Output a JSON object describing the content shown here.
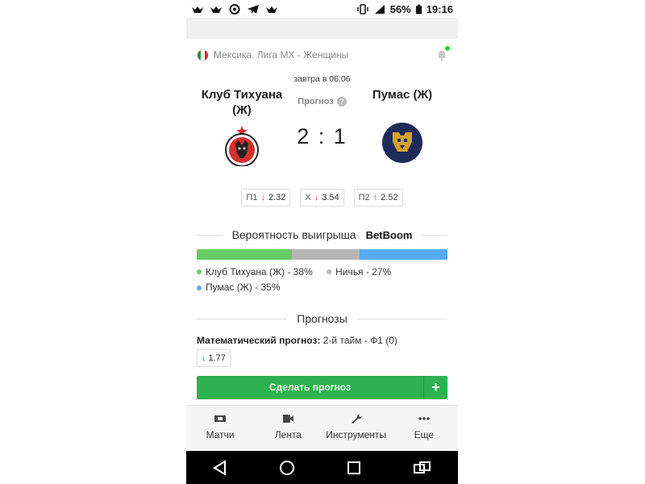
{
  "status_bar": {
    "battery": "56%",
    "time": "19:16"
  },
  "match": {
    "league": "Мексика. Лига MX - Женщины",
    "kickoff": "завтра в 06:06",
    "home": {
      "name": "Клуб Тихуана (Ж)"
    },
    "away": {
      "name": "Пумас (Ж)"
    },
    "forecast_label": "Прогноз",
    "score": "2 : 1"
  },
  "odds": [
    {
      "label": "П1",
      "value": "2.32",
      "trend": "down"
    },
    {
      "label": "Х",
      "value": "3.54",
      "trend": "down"
    },
    {
      "label": "П2",
      "value": "2.52",
      "trend": "up"
    }
  ],
  "probability": {
    "title": "Вероятность выигрыша",
    "brand": "BetBoom",
    "segments": [
      {
        "label": "Клуб Тихуана (Ж) - 38%",
        "percent": 38,
        "color": "#66cc66"
      },
      {
        "label": "Ничья - 27%",
        "percent": 27,
        "color": "#b5b5b5"
      },
      {
        "label": "Пумас (Ж) - 35%",
        "percent": 35,
        "color": "#55aaf5"
      }
    ]
  },
  "predictions": {
    "title": "Прогнозы",
    "math_label": "Математический прогноз:",
    "math_value": "2-й тайм - Ф1 (0)",
    "math_odd": "1.77",
    "cta_label": "Сделать прогноз",
    "cta_plus": "+"
  },
  "bottom_nav": [
    {
      "label": "Матчи",
      "icon": "ticket-icon"
    },
    {
      "label": "Лента",
      "icon": "video-icon"
    },
    {
      "label": "Инструменты",
      "icon": "wrench-icon"
    },
    {
      "label": "Еще",
      "icon": "more-icon"
    }
  ],
  "colors": {
    "accent": "#2cb24e",
    "home": "#66cc66",
    "draw": "#b5b5b5",
    "away": "#55aaf5",
    "down": "#e53935",
    "up": "#43a047"
  }
}
